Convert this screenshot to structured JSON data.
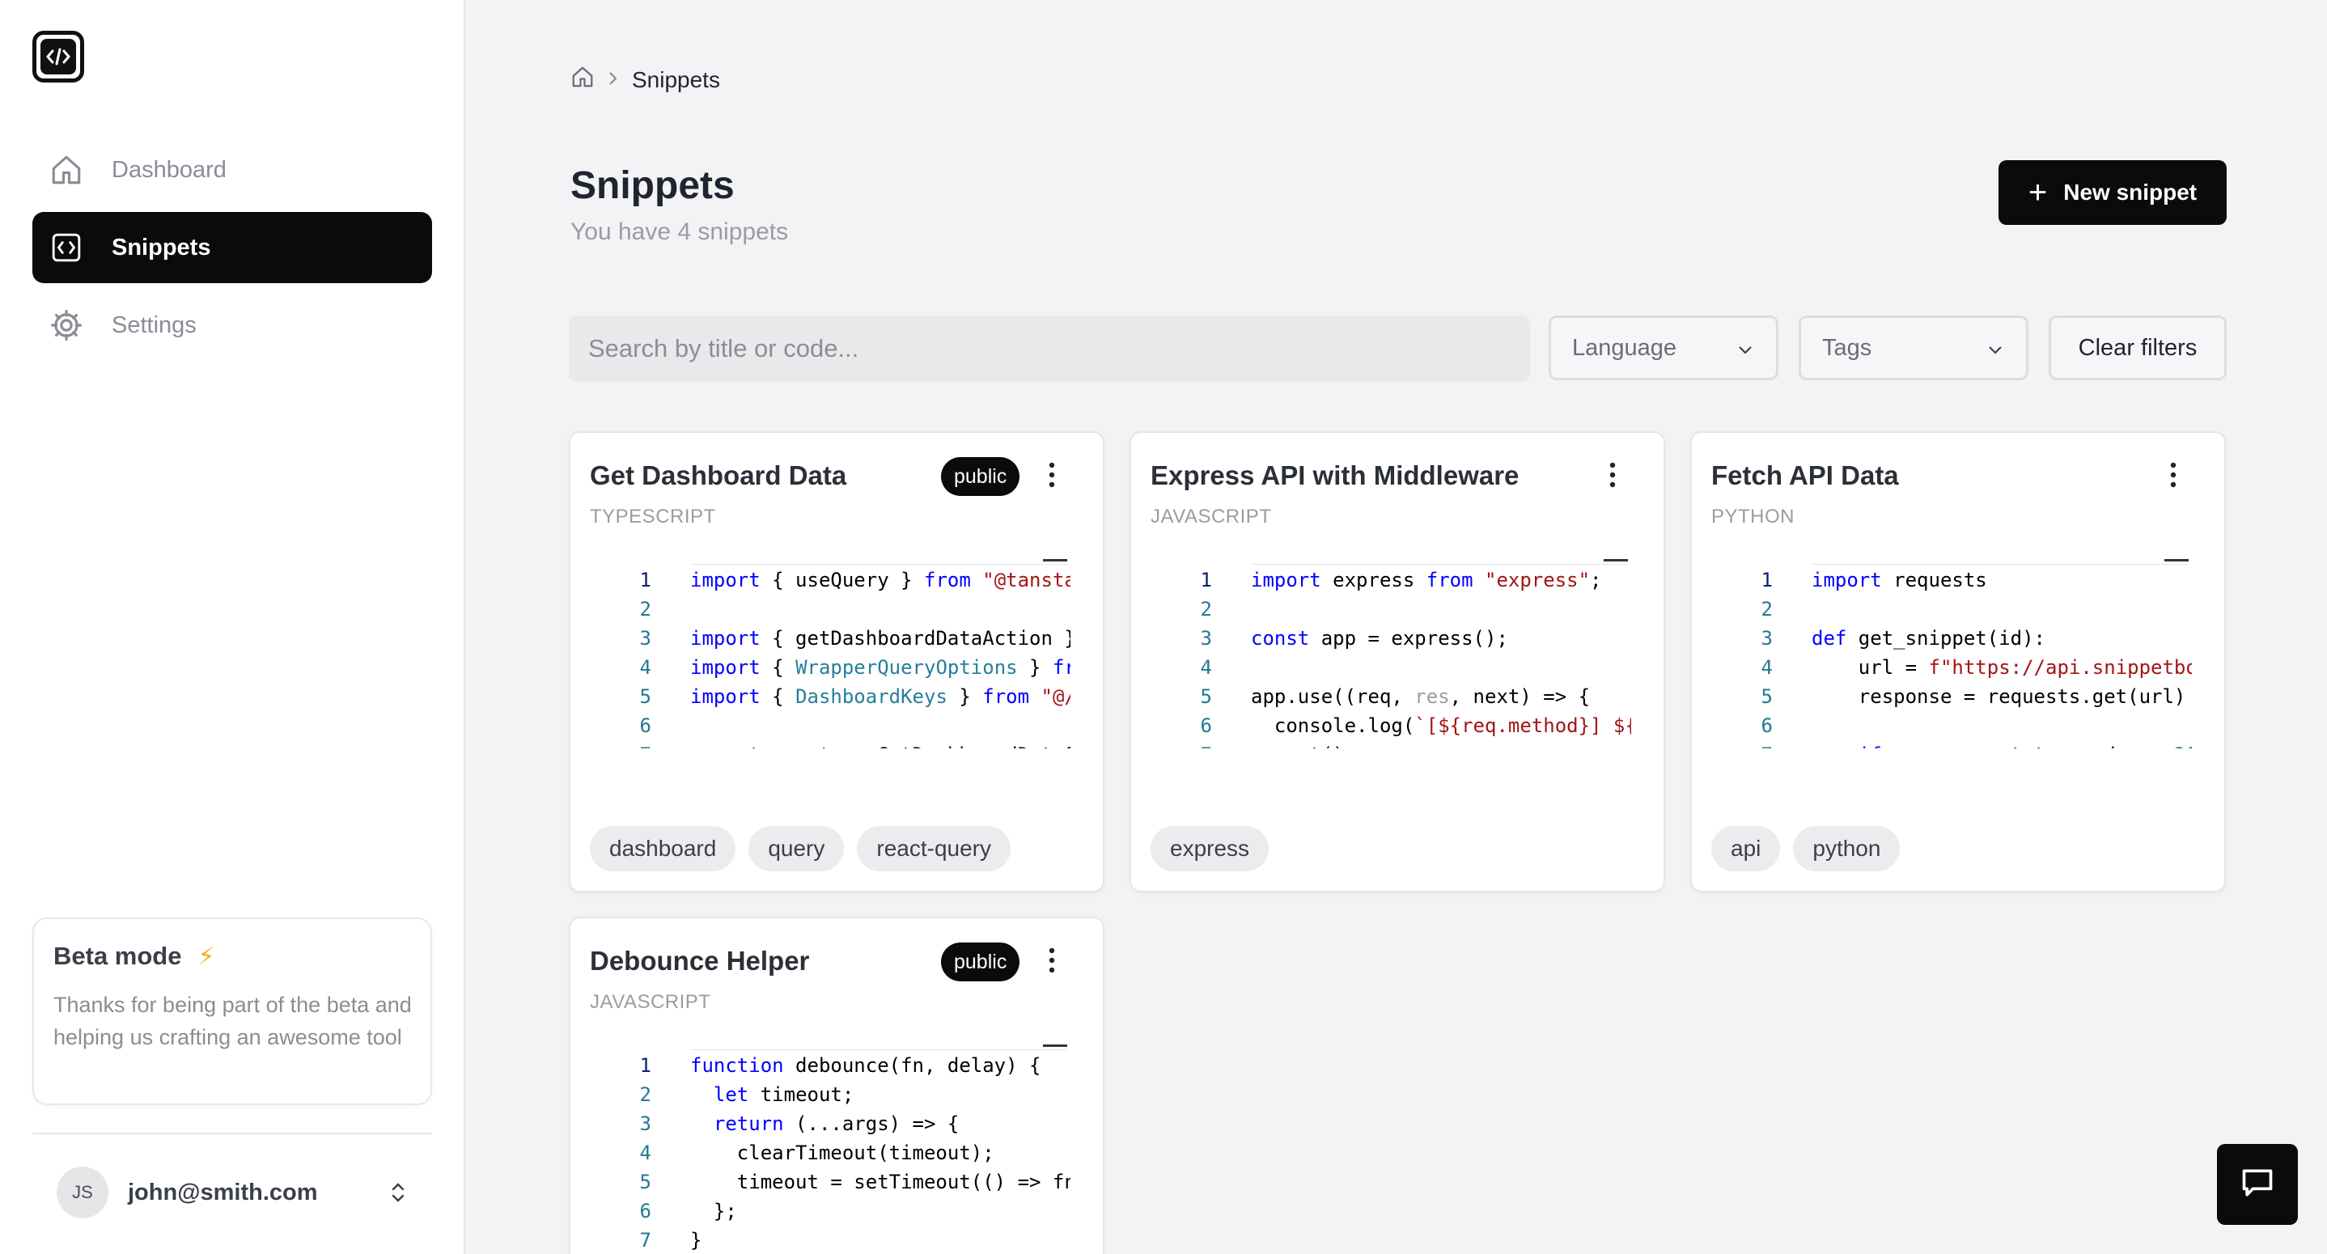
{
  "sidebar": {
    "nav": [
      {
        "label": "Dashboard",
        "icon": "home-icon"
      },
      {
        "label": "Snippets",
        "icon": "code-icon"
      },
      {
        "label": "Settings",
        "icon": "gear-icon"
      }
    ],
    "beta": {
      "title": "Beta mode",
      "text": "Thanks for being part of the beta and helping us crafting an awesome tool"
    },
    "user": {
      "initials": "JS",
      "email": "john@smith.com"
    }
  },
  "breadcrumb": {
    "current": "Snippets"
  },
  "header": {
    "title": "Snippets",
    "subtitle": "You have 4 snippets",
    "new_button": "New snippet"
  },
  "filters": {
    "search_placeholder": "Search by title or code...",
    "language": "Language",
    "tags": "Tags",
    "clear": "Clear filters"
  },
  "snippets": [
    {
      "title": "Get Dashboard Data",
      "language": "TYPESCRIPT",
      "badge": "public",
      "tags": [
        "dashboard",
        "query",
        "react-query"
      ]
    },
    {
      "title": "Express API with Middleware",
      "language": "JAVASCRIPT",
      "badge": "",
      "tags": [
        "express"
      ]
    },
    {
      "title": "Fetch API Data",
      "language": "PYTHON",
      "badge": "",
      "tags": [
        "api",
        "python"
      ]
    },
    {
      "title": "Debounce Helper",
      "language": "JAVASCRIPT",
      "badge": "public",
      "tags": []
    }
  ],
  "colors": {
    "accent": "#0b0b0c",
    "keyword": "#0000ff",
    "string": "#a31515",
    "type": "#267f99"
  }
}
